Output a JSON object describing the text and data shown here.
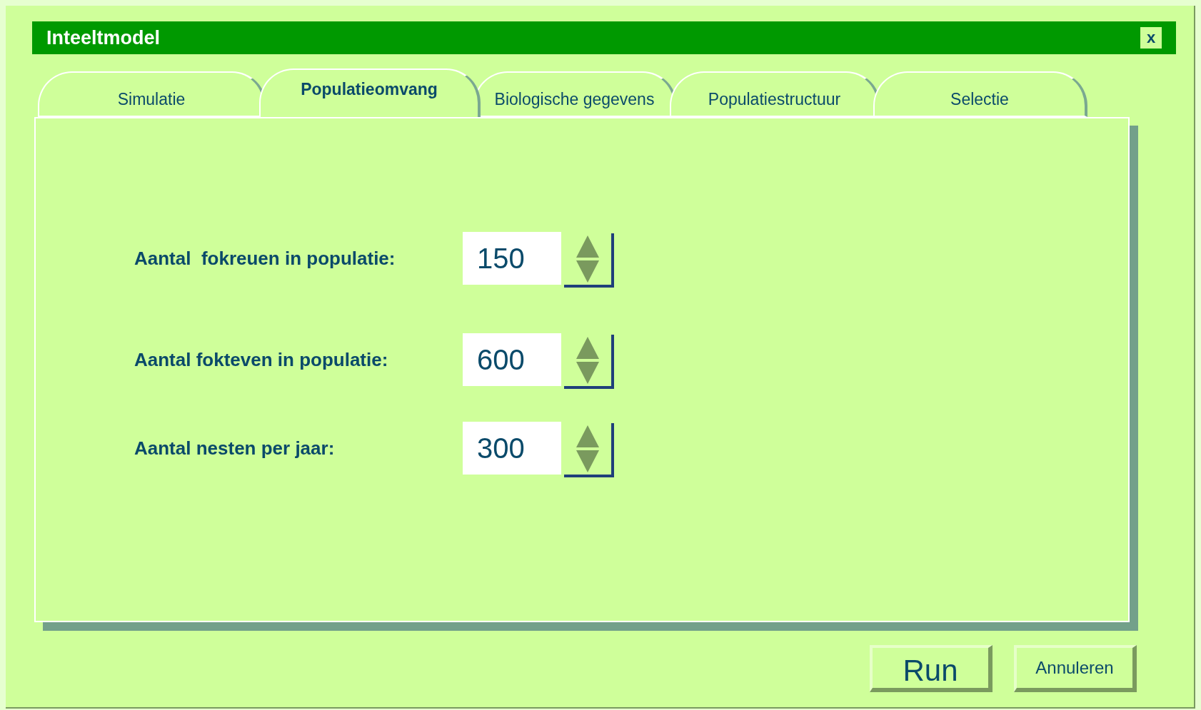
{
  "window": {
    "title": "Inteeltmodel",
    "close": "x"
  },
  "tabs": [
    {
      "label": "Simulatie",
      "selected": false
    },
    {
      "label": "Populatieomvang",
      "selected": true
    },
    {
      "label": "Biologische gegevens",
      "selected": false
    },
    {
      "label": "Populatiestructuur",
      "selected": false
    },
    {
      "label": "Selectie",
      "selected": false
    }
  ],
  "fields": [
    {
      "label": "Aantal  fokreuen in populatie:",
      "value": "150"
    },
    {
      "label": "Aantal fokteven in populatie:",
      "value": "600"
    },
    {
      "label": "Aantal nesten per jaar:",
      "value": "300"
    }
  ],
  "buttons": [
    {
      "label": "Run",
      "kind": "primary"
    },
    {
      "label": "Annuleren",
      "kind": "secondary"
    }
  ]
}
